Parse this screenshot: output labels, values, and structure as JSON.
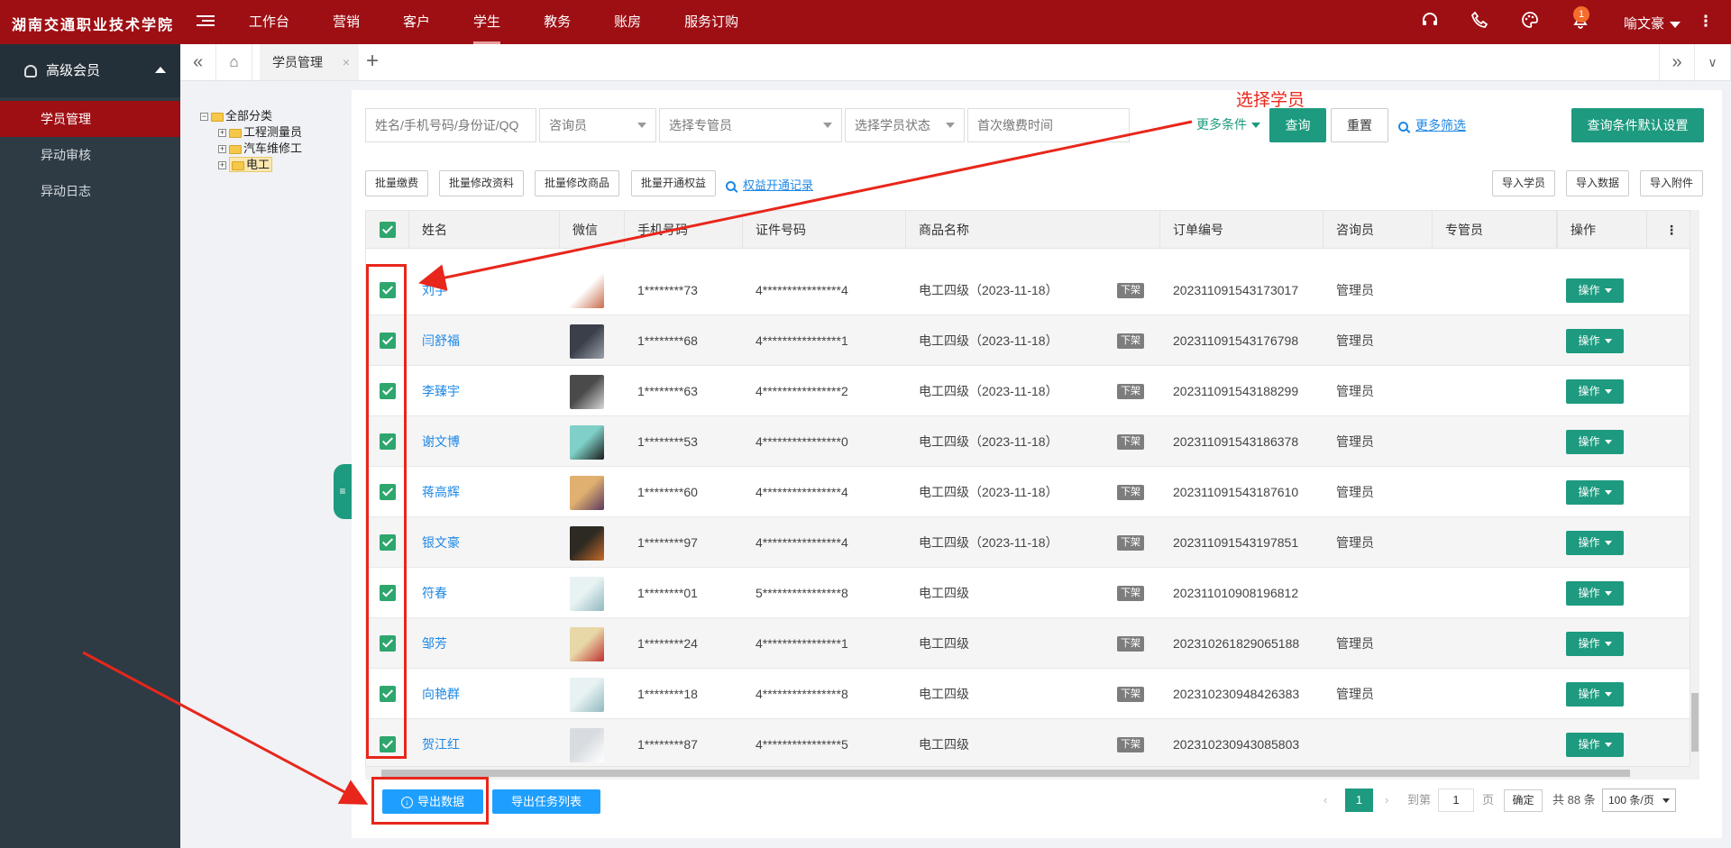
{
  "header": {
    "school": "湖南交通职业技术学院",
    "nav": [
      "工作台",
      "营销",
      "客户",
      "学生",
      "教务",
      "账房",
      "服务订购"
    ],
    "active_nav": "学生",
    "notification_count": "1",
    "user": "喻文豪"
  },
  "sidebar": {
    "section": "高级会员",
    "items": [
      {
        "label": "学员管理",
        "active": true
      },
      {
        "label": "异动审核",
        "active": false
      },
      {
        "label": "异动日志",
        "active": false
      }
    ]
  },
  "tabs": {
    "current": "学员管理",
    "close": "×",
    "add": "+"
  },
  "tree": {
    "root": "全部分类",
    "children": [
      "工程测量员",
      "汽车维修工",
      "电工"
    ],
    "selected": "电工"
  },
  "filters": {
    "search_placeholder": "姓名/手机号码/身份证/QQ",
    "consultant": "咨询员",
    "manager": "选择专管员",
    "status": "选择学员状态",
    "first_pay": "首次缴费时间",
    "more": "更多条件",
    "query": "查询",
    "reset": "重置",
    "more_filter": "更多筛选",
    "default_settings": "查询条件默认设置"
  },
  "actions": {
    "batch_pay": "批量缴费",
    "batch_edit_info": "批量修改资料",
    "batch_edit_goods": "批量修改商品",
    "batch_open_rights": "批量开通权益",
    "rights_record": "权益开通记录",
    "import_students": "导入学员",
    "import_data": "导入数据",
    "import_attachments": "导入附件"
  },
  "table": {
    "columns": [
      "姓名",
      "微信",
      "手机号码",
      "证件号码",
      "商品名称",
      "订单编号",
      "咨询员",
      "专管员",
      "操作"
    ],
    "rows": [
      {
        "name": "刘宇",
        "phone": "1********73",
        "id": "4****************4",
        "goods": "电工四级（2023-11-18）",
        "tag": "下架",
        "order": "20231109154317301​7",
        "consultant": "管理员",
        "op": "操作",
        "av": [
          "#ffffff",
          "#c96b4b"
        ]
      },
      {
        "name": "闫舒福",
        "phone": "1********68",
        "id": "4****************1",
        "goods": "电工四级（2023-11-18）",
        "tag": "下架",
        "order": "20231109154317679​8",
        "consultant": "管理员",
        "op": "操作",
        "av": [
          "#3a3f4a",
          "#9aa0aa"
        ]
      },
      {
        "name": "李臻宇",
        "phone": "1********63",
        "id": "4****************2",
        "goods": "电工四级（2023-11-18）",
        "tag": "下架",
        "order": "20231109154318829​9",
        "consultant": "管理员",
        "op": "操作",
        "av": [
          "#4a4a4a",
          "#d8d8d8"
        ]
      },
      {
        "name": "谢文博",
        "phone": "1********53",
        "id": "4****************0",
        "goods": "电工四级（2023-11-18）",
        "tag": "下架",
        "order": "20231109154318637​8",
        "consultant": "管理员",
        "op": "操作",
        "av": [
          "#7fd0c8",
          "#1a1a1a"
        ]
      },
      {
        "name": "蒋高辉",
        "phone": "1********60",
        "id": "4****************4",
        "goods": "电工四级（2023-11-18）",
        "tag": "下架",
        "order": "20231109154318761​0",
        "consultant": "管理员",
        "op": "操作",
        "av": [
          "#e0b070",
          "#5a3a60"
        ]
      },
      {
        "name": "银文豪",
        "phone": "1********97",
        "id": "4****************4",
        "goods": "电工四级（2023-11-18）",
        "tag": "下架",
        "order": "20231109154319785​1",
        "consultant": "管理员",
        "op": "操作",
        "av": [
          "#2c2a22",
          "#c86a2a"
        ]
      },
      {
        "name": "符春",
        "phone": "1********01",
        "id": "5****************8",
        "goods": "电工四级",
        "tag": "下架",
        "order": "20231101090819681​2",
        "consultant": "",
        "op": "操作",
        "av": [
          "#e8f2f2",
          "#90b8c0"
        ]
      },
      {
        "name": "邹芳",
        "phone": "1********24",
        "id": "4****************1",
        "goods": "电工四级",
        "tag": "下架",
        "order": "20231026182906518​8",
        "consultant": "管理员",
        "op": "操作",
        "av": [
          "#e8d8a8",
          "#c03030"
        ]
      },
      {
        "name": "向艳群",
        "phone": "1********18",
        "id": "4****************8",
        "goods": "电工四级",
        "tag": "下架",
        "order": "20231023094842638​3",
        "consultant": "管理员",
        "op": "操作",
        "av": [
          "#e8f2f2",
          "#90b8c0"
        ]
      },
      {
        "name": "贺江红",
        "phone": "1********87",
        "id": "4****************5",
        "goods": "电工四级",
        "tag": "下架",
        "order": "20231023094308580​3",
        "consultant": "",
        "op": "操作",
        "av": [
          "#d8dce0",
          "#ffffff"
        ]
      }
    ]
  },
  "footer": {
    "export_data": "导出数据",
    "export_tasks": "导出任务列表",
    "page_current": "1",
    "goto_label": "到第",
    "goto_value": "1",
    "page_unit": "页",
    "confirm": "确定",
    "total": "共 88 条",
    "page_size": "100 条/页"
  },
  "annotation": {
    "text": "选择学员",
    "color": "#e8261b"
  },
  "colors": {
    "brand": "#9e0f14",
    "primary": "#1d9a7f",
    "link": "#1e88e5",
    "export": "#1e9fff"
  }
}
